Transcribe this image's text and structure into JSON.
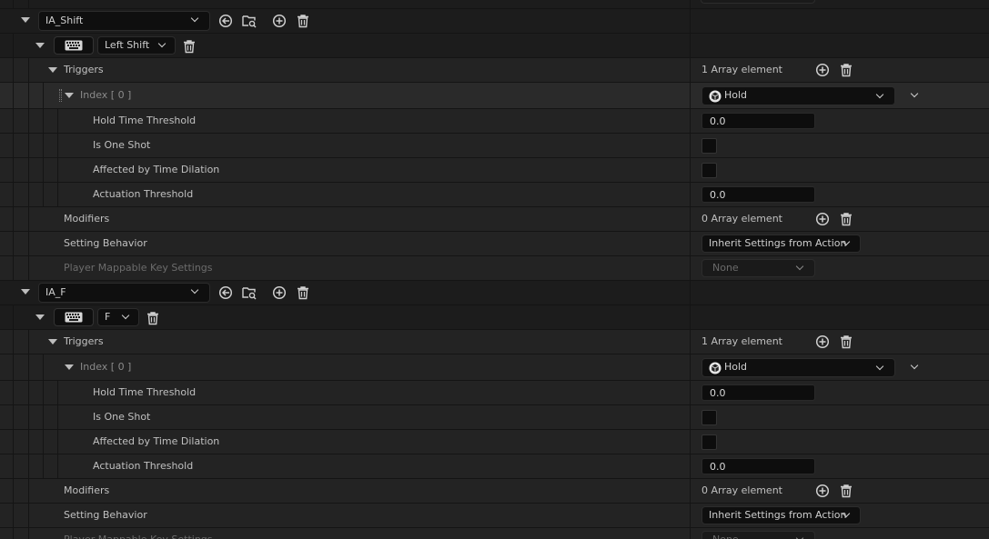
{
  "groups": [
    {
      "action": "IA_Shift",
      "key": "Left Shift",
      "triggers_label": "Triggers",
      "triggers_count": "1 Array element",
      "index_label": "Index [ 0 ]",
      "trigger_type": "Hold",
      "hold_time_label": "Hold Time Threshold",
      "hold_time_value": "0.0",
      "one_shot_label": "Is One Shot",
      "time_dilation_label": "Affected by Time Dilation",
      "actuation_label": "Actuation Threshold",
      "actuation_value": "0.0",
      "modifiers_label": "Modifiers",
      "modifiers_count": "0 Array element",
      "setting_label": "Setting Behavior",
      "setting_value": "Inherit Settings from Action",
      "player_key_label": "Player Mappable Key Settings",
      "player_key_value": "None"
    },
    {
      "action": "IA_F",
      "key": "F",
      "triggers_label": "Triggers",
      "triggers_count": "1 Array element",
      "index_label": "Index [ 0 ]",
      "trigger_type": "Hold",
      "hold_time_label": "Hold Time Threshold",
      "hold_time_value": "0.0",
      "one_shot_label": "Is One Shot",
      "time_dilation_label": "Affected by Time Dilation",
      "actuation_label": "Actuation Threshold",
      "actuation_value": "0.0",
      "modifiers_label": "Modifiers",
      "modifiers_count": "0 Array element",
      "setting_label": "Setting Behavior",
      "setting_value": "Inherit Settings from Action",
      "player_key_label": "Player Mappable Key Settings",
      "player_key_value": "None"
    }
  ],
  "icons": [
    "chevron-down-icon",
    "browse-back-icon",
    "find-asset-icon",
    "add-icon",
    "delete-icon",
    "keyboard-icon",
    "input-trigger-icon"
  ]
}
